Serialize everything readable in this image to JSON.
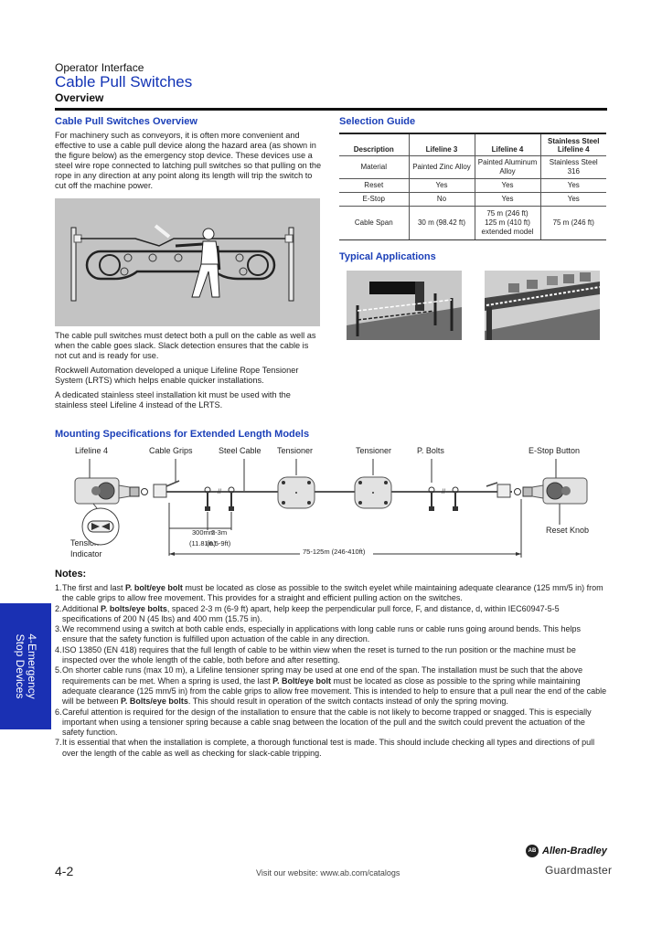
{
  "header": {
    "subtitle": "Operator Interface",
    "title": "Cable Pull Switches",
    "section": "Overview"
  },
  "overview": {
    "title": "Cable Pull Switches Overview",
    "intro": "For machinery such as conveyors, it is often more convenient and effective to use a cable pull device along the hazard area (as shown in the figure below) as the emergency stop device. These devices use a steel wire rope connected to latching pull switches so that pulling on the rope in any direction at any point along its length will trip the switch to cut off the machine power.",
    "figure_icon": "conveyor-cable-pull-illustration",
    "paragraphs": [
      "The cable pull switches must detect both a pull on the cable as well as when the cable goes slack. Slack detection ensures that the cable is not cut and is ready for use.",
      "Rockwell Automation developed a unique Lifeline Rope Tensioner System (LRTS) which helps enable quicker installations.",
      "A dedicated stainless steel installation kit must be used with the stainless steel Lifeline 4 instead of the LRTS."
    ]
  },
  "selection_guide": {
    "title": "Selection Guide",
    "headers": [
      "Description",
      "Lifeline 3",
      "Lifeline 4",
      "Stainless Steel Lifeline 4"
    ],
    "rows": [
      [
        "Material",
        "Painted Zinc Alloy",
        "Painted Aluminum Alloy",
        "Stainless Steel 316"
      ],
      [
        "Reset",
        "Yes",
        "Yes",
        "Yes"
      ],
      [
        "E-Stop",
        "No",
        "Yes",
        "Yes"
      ],
      [
        "Cable Span",
        "30 m (98.42 ft)",
        "75 m (246 ft) 125 m (410 ft) extended model",
        "75 m (246 ft)"
      ]
    ]
  },
  "typical_applications": {
    "title": "Typical Applications",
    "images": [
      "perimeter-guard-rope-image",
      "conveyor-rope-image"
    ]
  },
  "mounting": {
    "title": "Mounting Specifications for Extended Length Models",
    "labels": {
      "lifeline4": "Lifeline 4",
      "cable_grips": "Cable Grips",
      "steel_cable": "Steel Cable",
      "tensioner1": "Tensioner",
      "tensioner2": "Tensioner",
      "p_bolts": "P. Bolts",
      "estop_button": "E-Stop Button",
      "reset_knob": "Reset Knob",
      "tension_indicator_1": "Tension",
      "tension_indicator_2": "Indicator"
    },
    "dimensions": {
      "d1_top": "300mm",
      "d1_bottom": "(11.81in)",
      "d2_top": "2-3m",
      "d2_bottom": "(6.5-9ft)",
      "span": "75-125m (246-410ft)"
    }
  },
  "notes": {
    "title": "Notes:",
    "items": [
      {
        "num": "1.",
        "parts": [
          {
            "t": "The first and last "
          },
          {
            "t": "P. bolt/eye bolt",
            "b": true
          },
          {
            "t": " must be located as close as possible to the switch eyelet while maintaining adequate clearance (125 mm/5 in) from the cable grips to allow free movement. This provides for a straight and efficient pulling action on the switches."
          }
        ]
      },
      {
        "num": "2.",
        "parts": [
          {
            "t": "Additional "
          },
          {
            "t": "P. bolts/eye bolts",
            "b": true
          },
          {
            "t": ", spaced 2-3 m (6-9 ft) apart, help keep the perpendicular pull force, F, and distance, d, within IEC60947-5-5 specifications of 200 N (45 lbs) and 400 mm (15.75 in)."
          }
        ]
      },
      {
        "num": "3.",
        "parts": [
          {
            "t": "We recommend using a switch at both cable ends, especially in applications with long cable runs or cable runs going around bends. This helps ensure that the safety function is fulfilled upon actuation of the cable in any direction."
          }
        ]
      },
      {
        "num": "4.",
        "parts": [
          {
            "t": "ISO 13850 (EN 418) requires that the full length of cable to be within view when the reset is turned to the run position or the machine must be inspected over the whole length of the cable, both before and after resetting."
          }
        ]
      },
      {
        "num": "5.",
        "parts": [
          {
            "t": "On shorter cable runs (max 10 m), a Lifeline tensioner spring may be used at one end of the span. The installation must be such that the above requirements can be met. When a spring is used, the last "
          },
          {
            "t": "P. Bolt/eye bolt",
            "b": true
          },
          {
            "t": " must be located as close as possible to the spring while maintaining adequate clearance (125 mm/5 in) from the cable grips to allow free movement. This is intended to help to ensure that a pull near the end of the cable will be between "
          },
          {
            "t": "P. Bolts/eye bolts",
            "b": true
          },
          {
            "t": ". This should result in operation of the switch contacts instead of only the spring moving."
          }
        ]
      },
      {
        "num": "6.",
        "parts": [
          {
            "t": "Careful attention is required for the design of the installation to ensure that the cable is not likely to become trapped or snagged. This is especially important when using a tensioner spring because a cable snag between the location of the pull and the switch could prevent the actuation of the safety function."
          }
        ]
      },
      {
        "num": "7.",
        "parts": [
          {
            "t": "It is essential that when the installation is complete, a thorough functional test is made. This should include checking all types and directions of pull over the length of the cable as well as checking for slack-cable tripping."
          }
        ]
      }
    ]
  },
  "side_tab": {
    "line1": "4-Emergency",
    "line2": "Stop Devices",
    "color": "#1a30b3"
  },
  "footer": {
    "page_number": "4-2",
    "website": "Visit our website: www.ab.com/catalogs",
    "brand": "Allen-Bradley",
    "brand_badge": "AB",
    "sub_brand": "Guardmaster"
  },
  "colors": {
    "accent": "#1b3fb8",
    "figure_bg": "#c3c3c3"
  }
}
